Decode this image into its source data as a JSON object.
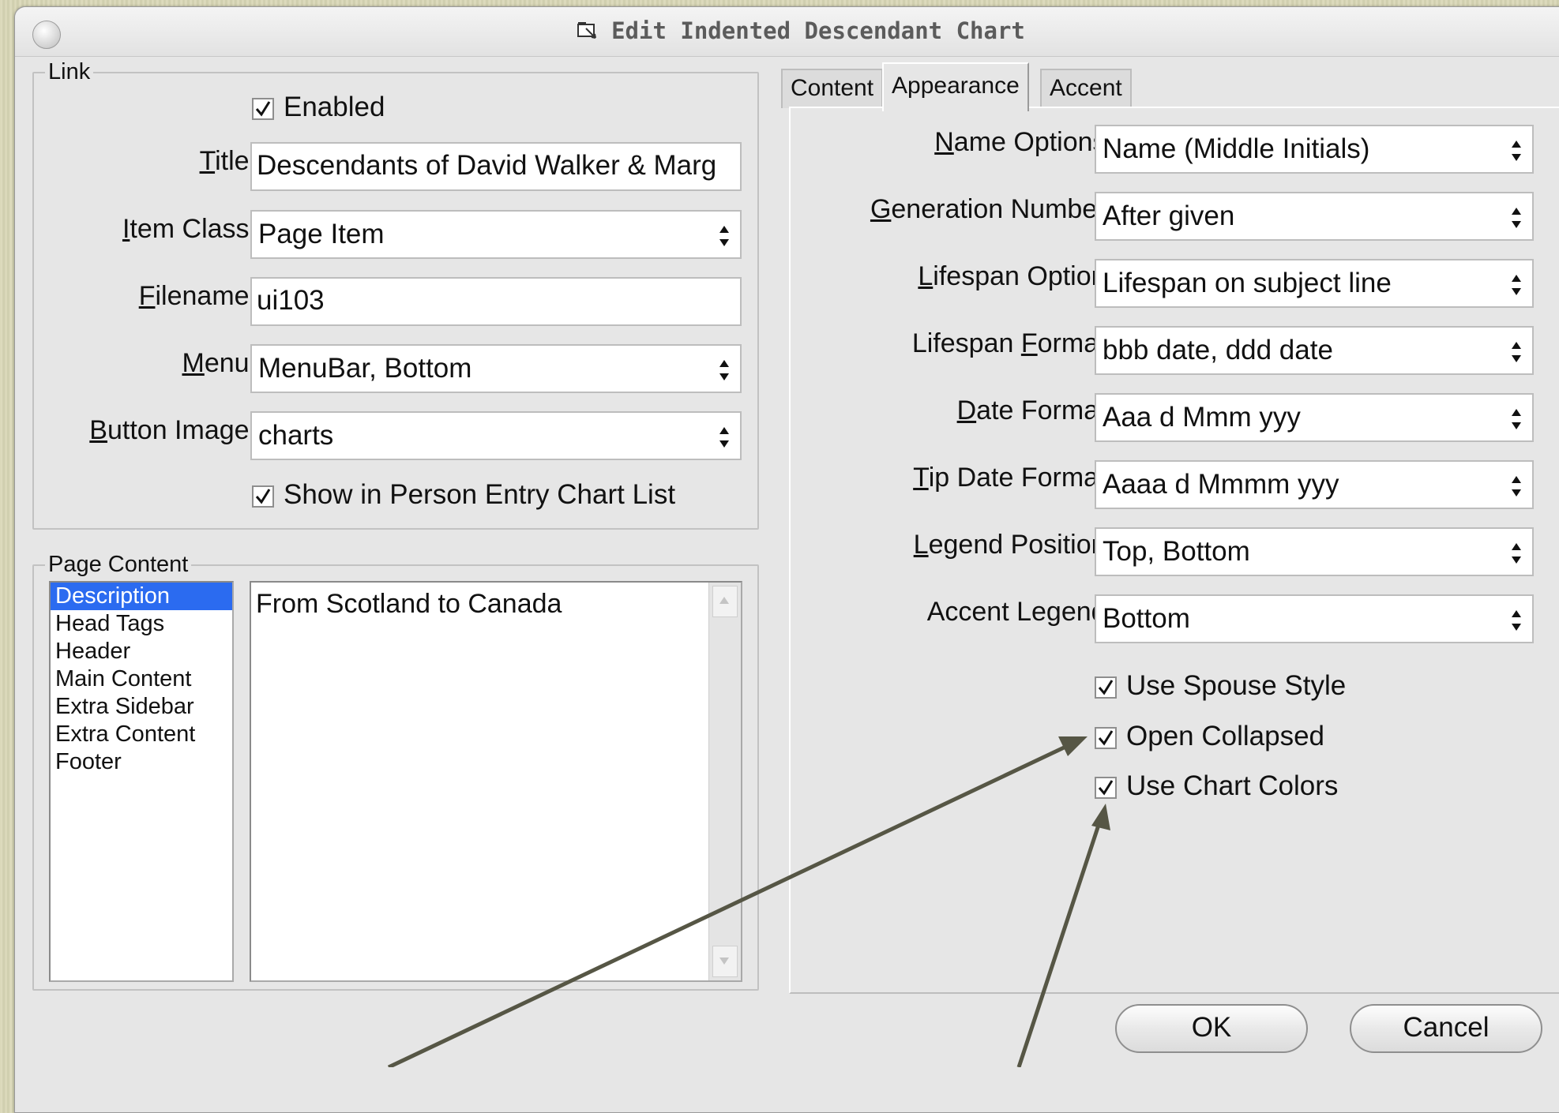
{
  "window": {
    "title": "Edit Indented Descendant Chart",
    "title_icon": "chart-icon"
  },
  "link": {
    "legend": "Link",
    "enabled": {
      "label": "Enabled",
      "checked": true
    },
    "title": {
      "label": "Title:",
      "value": "Descendants of David Walker & Marg"
    },
    "item_class": {
      "label": "Item Class:",
      "value": "Page Item"
    },
    "filename": {
      "label": "Filename:",
      "value": "ui103"
    },
    "menu": {
      "label": "Menu:",
      "value": "MenuBar, Bottom"
    },
    "button_image": {
      "label": "Button Image:",
      "value": "charts"
    },
    "show_in_list": {
      "label": "Show in Person Entry Chart List",
      "checked": true
    }
  },
  "page_content": {
    "legend": "Page Content",
    "sections": [
      "Description",
      "Head Tags",
      "Header",
      "Main Content",
      "Extra Sidebar",
      "Extra Content",
      "Footer"
    ],
    "selected": "Description",
    "text": "From Scotland to Canada"
  },
  "tabs": [
    {
      "label": "Content",
      "active": false
    },
    {
      "label": "Appearance",
      "active": true
    },
    {
      "label": "Accent",
      "active": false
    }
  ],
  "appearance": {
    "name_options": {
      "label": "Name Options:",
      "value": "Name (Middle Initials)"
    },
    "generation_number": {
      "label": "Generation Number:",
      "value": "After given"
    },
    "lifespan_option": {
      "label": "Lifespan Option:",
      "value": "Lifespan on subject line"
    },
    "lifespan_format": {
      "label": "Lifespan Format:",
      "value": "bbb date, ddd date"
    },
    "date_format": {
      "label": "Date Format:",
      "value": "Aaa d Mmm yyy"
    },
    "tip_date_format": {
      "label": "Tip Date Format:",
      "value": "Aaaa d Mmmm yyy"
    },
    "legend_position": {
      "label": "Legend Position:",
      "value": "Top, Bottom"
    },
    "accent_legend": {
      "label": "Accent Legend:",
      "value": "Bottom"
    },
    "use_spouse_style": {
      "label": "Use Spouse Style",
      "checked": true
    },
    "open_collapsed": {
      "label": "Open Collapsed",
      "checked": true
    },
    "use_chart_colors": {
      "label": "Use Chart Colors",
      "checked": true
    }
  },
  "buttons": {
    "ok": "OK",
    "cancel": "Cancel"
  },
  "colors": {
    "selection": "#2b6bf0",
    "annotation_arrow": "#565645",
    "window_bg": "#e6e6e6"
  }
}
